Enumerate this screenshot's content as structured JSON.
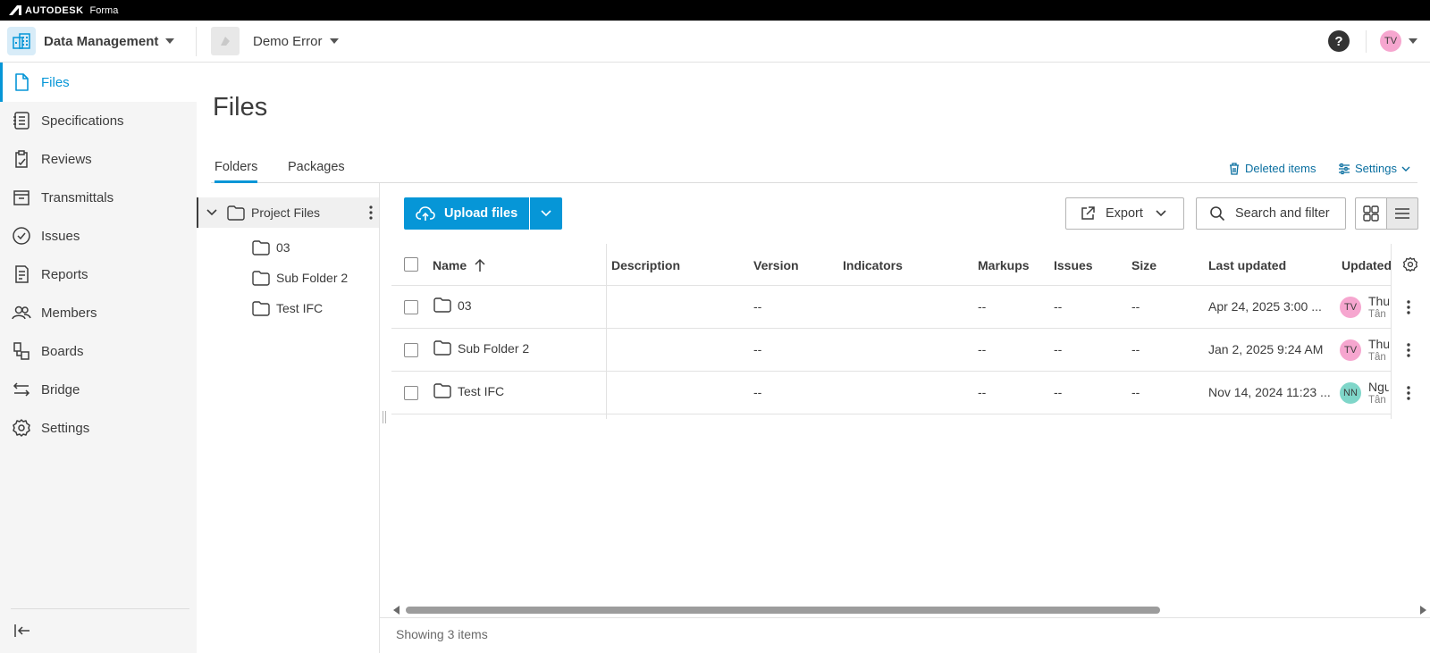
{
  "brand": {
    "name": "AUTODESK",
    "product": "Forma"
  },
  "header": {
    "module_title": "Data Management",
    "project_title": "Demo Error",
    "help_label": "?",
    "user_initials": "TV"
  },
  "sidebar": {
    "items": [
      {
        "label": "Files",
        "icon": "file-icon",
        "active": true
      },
      {
        "label": "Specifications",
        "icon": "specifications-icon"
      },
      {
        "label": "Reviews",
        "icon": "reviews-icon"
      },
      {
        "label": "Transmittals",
        "icon": "transmittals-icon"
      },
      {
        "label": "Issues",
        "icon": "issues-icon"
      },
      {
        "label": "Reports",
        "icon": "reports-icon"
      },
      {
        "label": "Members",
        "icon": "members-icon"
      },
      {
        "label": "Boards",
        "icon": "boards-icon"
      },
      {
        "label": "Bridge",
        "icon": "bridge-icon"
      },
      {
        "label": "Settings",
        "icon": "gear-icon"
      }
    ]
  },
  "page": {
    "title": "Files"
  },
  "tabs": [
    {
      "label": "Folders",
      "active": true
    },
    {
      "label": "Packages",
      "active": false
    }
  ],
  "links": {
    "deleted_items": "Deleted items",
    "settings": "Settings"
  },
  "tree": {
    "root": "Project Files",
    "children": [
      "03",
      "Sub Folder 2",
      "Test IFC"
    ]
  },
  "toolbar": {
    "upload": "Upload files",
    "export": "Export",
    "search": "Search and filter"
  },
  "table": {
    "columns": [
      "Name",
      "Description",
      "Version",
      "Indicators",
      "Markups",
      "Issues",
      "Size",
      "Last updated",
      "Updated"
    ],
    "rows": [
      {
        "name": "03",
        "description": "",
        "version": "--",
        "markups": "--",
        "issues": "--",
        "size": "--",
        "last_updated": "Apr 24, 2025 3:00 ...",
        "user_initials": "TV",
        "user_name": "Thu",
        "user_sub": "Tân",
        "avatar_color": "#f6a6cf"
      },
      {
        "name": "Sub Folder 2",
        "description": "",
        "version": "--",
        "markups": "--",
        "issues": "--",
        "size": "--",
        "last_updated": "Jan 2, 2025 9:24 AM",
        "user_initials": "TV",
        "user_name": "Thu",
        "user_sub": "Tân",
        "avatar_color": "#f6a6cf"
      },
      {
        "name": "Test IFC",
        "description": "",
        "version": "--",
        "markups": "--",
        "issues": "--",
        "size": "--",
        "last_updated": "Nov 14, 2024 11:23 ...",
        "user_initials": "NN",
        "user_name": "Ngu",
        "user_sub": "Tân",
        "avatar_color": "#7fd6c9"
      }
    ]
  },
  "footer": {
    "status": "Showing 3 items"
  },
  "colors": {
    "accent": "#0696d7",
    "link": "#0a6fa0",
    "sidebar_bg": "#f5f5f5"
  }
}
